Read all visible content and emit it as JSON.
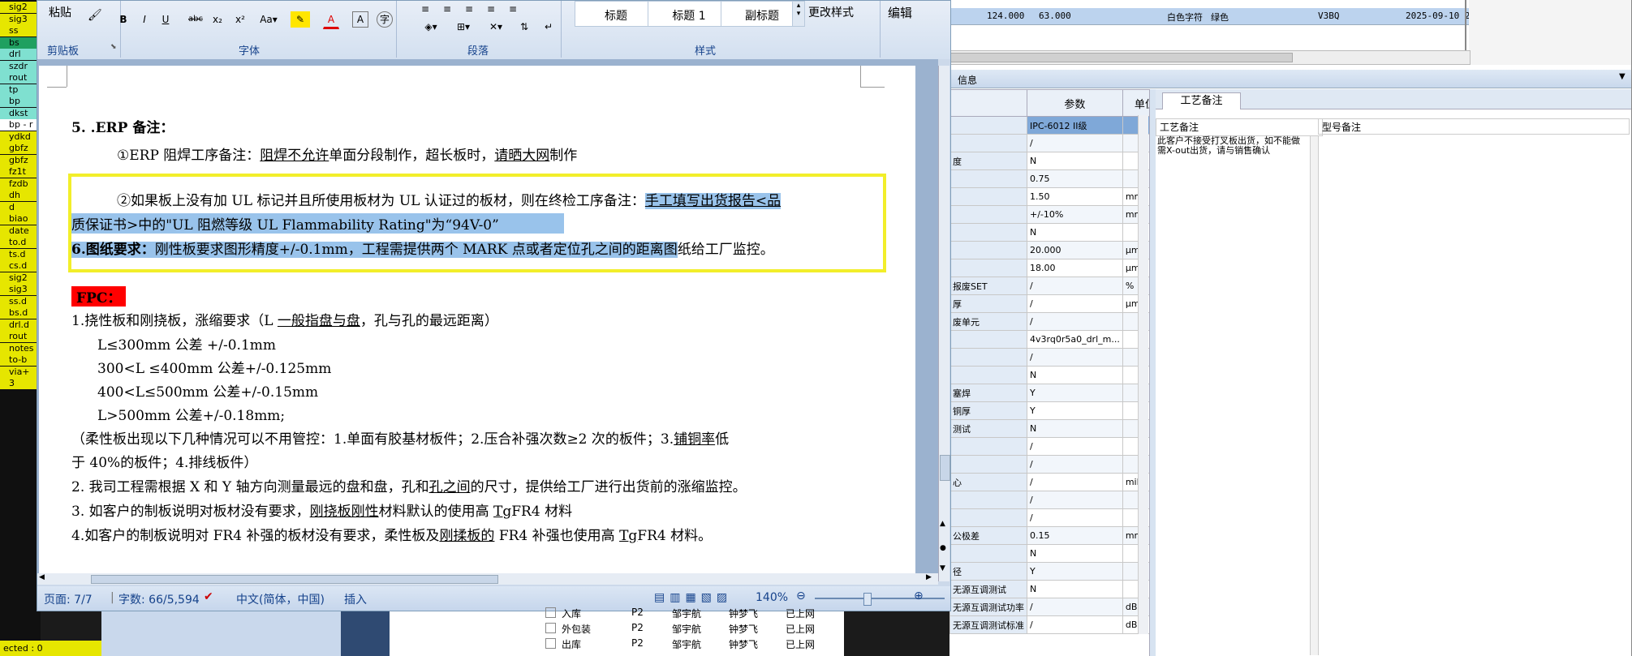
{
  "left_items": [
    {
      "t": "sig2",
      "c": "#e6e600"
    },
    {
      "t": "sig3",
      "c": "#e6e600"
    },
    {
      "t": "ss",
      "c": "#e6e600"
    },
    {
      "t": "bs",
      "c": "#1fa060"
    },
    {
      "t": "drl",
      "c": "#7fe0d0"
    },
    {
      "t": "szdr",
      "c": "#7fe0d0"
    },
    {
      "t": "rout",
      "c": "#7fe0d0"
    },
    {
      "t": "tp",
      "c": "#7fe0d0"
    },
    {
      "t": "bp",
      "c": "#7fe0d0"
    },
    {
      "t": "dkst",
      "c": "#7fe0d0"
    },
    {
      "t": "bp - r",
      "c": "#ffffff"
    },
    {
      "t": "ydkd",
      "c": "#e6e600"
    },
    {
      "t": "gbfz",
      "c": "#e6e600"
    },
    {
      "t": "gbfz",
      "c": "#e6e600"
    },
    {
      "t": "fz1t",
      "c": "#e6e600"
    },
    {
      "t": "fzdb",
      "c": "#e6e600"
    },
    {
      "t": "dh",
      "c": "#e6e600"
    },
    {
      "t": "d",
      "c": "#e6e600"
    },
    {
      "t": "biao",
      "c": "#e6e600"
    },
    {
      "t": "date",
      "c": "#e6e600"
    },
    {
      "t": "to.d",
      "c": "#e6e600"
    },
    {
      "t": "ts.d",
      "c": "#e6e600"
    },
    {
      "t": "cs.d",
      "c": "#e6e600"
    },
    {
      "t": "sig2",
      "c": "#e6e600"
    },
    {
      "t": "sig3",
      "c": "#e6e600"
    },
    {
      "t": "ss.d",
      "c": "#e6e600"
    },
    {
      "t": "bs.d",
      "c": "#e6e600"
    },
    {
      "t": "drl.d",
      "c": "#e6e600"
    },
    {
      "t": "rout",
      "c": "#e6e600"
    },
    {
      "t": "notes",
      "c": "#e6e600"
    },
    {
      "t": "to-b",
      "c": "#e6e600"
    },
    {
      "t": "via+",
      "c": "#e6e600"
    },
    {
      "t": "3",
      "c": "#e6e600"
    }
  ],
  "left_footer": "ected : 0",
  "word": {
    "ribbon": {
      "paste": "粘贴",
      "clipboard": "剪贴板",
      "font": "字体",
      "paragraph": "段落",
      "styles": "样式",
      "edit": "编辑",
      "change_styles": "更改样式",
      "style_boxes": [
        "标题",
        "标题 1",
        "副标题"
      ]
    },
    "doc": {
      "l1": "5. .ERP 备注：",
      "l2a": "①ERP 阻焊工序备注：",
      "l2b": "阻焊不允许",
      "l2c": "单面分段制作，超长板时，",
      "l2d": "请晒大网",
      "l2e": "制作",
      "l3a": "②如果板上没有加 UL 标记并且所使用板材为 UL 认证过的板材，则在终检工序备注：",
      "l3b": "手工填写出货报告<品",
      "l4": "质保证书>中的\"UL 阻燃等级 UL Flammability Rating\"为“94V-0”",
      "l5a": "6.图纸要求：",
      "l5b": "刚性板要求图形精度+/-0.1mm，工程需提供两个 MARK 点或者定位孔之间的距离图",
      "l5c": "纸给工厂监控。",
      "fpc": "FPC：",
      "l6a": "1.挠性板和刚挠板，涨缩要求（L ",
      "l6b": "一般指盘与盘",
      "l6c": "，孔与孔的最远距离）",
      "l7": "L≤300mm 公差 +/-0.1mm",
      "l8": "300<L ≤400mm 公差+/-0.125mm",
      "l9": "400<L≤500mm 公差+/-0.15mm",
      "l10": "L>500mm 公差+/-0.18mm;",
      "l11a": "（柔性板出现以下几种情况可以不用管控：1.单面有胶基材板件；2.压合补强次数≥2 次的板件；3.",
      "l11b": "铺铜率",
      "l11c": "低",
      "l12": "于 40%的板件；4.排线板件）",
      "l13a": "2.    我司工程需根据 X 和 Y 轴方向测量最远的盘和盘，孔和",
      "l13b": "孔之间",
      "l13c": "的尺寸，提供给工厂进行出货前的涨缩监控。",
      "l14a": "3. 如客户的制板说明对板材没有要求，",
      "l14b": "刚挠板刚性",
      "l14c": "材料默认的使用高 ",
      "l14d": "Tg",
      "l14e": "FR4 材料",
      "l15a": "4.如客户的制板说明对 FR4 补强的板材没有要求，柔性板及",
      "l15b": "刚揉板的",
      "l15c": " FR4 补强也使用高 ",
      "l15d": "Tg",
      "l15e": "FR4 材料。"
    },
    "status": {
      "page": "页面: 7/7",
      "words": "字数: 66/5,594",
      "lang": "中文(简体，中国)",
      "mode": "插入",
      "zoom": "140%"
    }
  },
  "right": {
    "top_row": {
      "a": "124.000",
      "b": "63.000",
      "c": "白色字符",
      "d": "绿色",
      "e": "V3BQ",
      "f": "2025-09-10 2"
    },
    "bar_label": "信息",
    "tab": "工艺备注",
    "col_param": "参数",
    "col_unit": "单位",
    "proc_col1": "工艺备注",
    "proc_col2": "型号备注",
    "proc_text": "此客户不接受打叉板出货，如不能做需X-out出货，请与销售确认",
    "rows": [
      {
        "n": "",
        "p": "IPC-6012 II级",
        "u": ""
      },
      {
        "n": "",
        "p": "/",
        "u": ""
      },
      {
        "n": "度",
        "p": "N",
        "u": ""
      },
      {
        "n": "",
        "p": "0.75",
        "u": ""
      },
      {
        "n": "",
        "p": "1.50",
        "u": "mm"
      },
      {
        "n": "",
        "p": "+/-10%",
        "u": "mm"
      },
      {
        "n": "",
        "p": "N",
        "u": ""
      },
      {
        "n": "",
        "p": "20.000",
        "u": "μm"
      },
      {
        "n": "",
        "p": "18.00",
        "u": "μm"
      },
      {
        "n": "报废SET",
        "p": "/",
        "u": "%"
      },
      {
        "n": "厚",
        "p": "/",
        "u": "μm"
      },
      {
        "n": "废单元",
        "p": "/",
        "u": ""
      },
      {
        "n": "",
        "p": "4v3rq0r5a0_drl_m...",
        "u": ""
      },
      {
        "n": "",
        "p": "/",
        "u": ""
      },
      {
        "n": "",
        "p": "N",
        "u": ""
      },
      {
        "n": "塞焊",
        "p": "Y",
        "u": ""
      },
      {
        "n": "铜厚",
        "p": "Y",
        "u": ""
      },
      {
        "n": "测试",
        "p": "N",
        "u": ""
      },
      {
        "n": "",
        "p": "/",
        "u": ""
      },
      {
        "n": "",
        "p": "/",
        "u": ""
      },
      {
        "n": "心",
        "p": "/",
        "u": "mil"
      },
      {
        "n": "",
        "p": "/",
        "u": ""
      },
      {
        "n": "",
        "p": "/",
        "u": ""
      },
      {
        "n": "公极差",
        "p": "0.15",
        "u": "mm/inch"
      },
      {
        "n": "",
        "p": "N",
        "u": ""
      },
      {
        "n": "径",
        "p": "Y",
        "u": ""
      },
      {
        "n": "无源互调测试",
        "p": "N",
        "u": ""
      },
      {
        "n": "无源互调测试功率",
        "p": "/",
        "u": "dBm"
      },
      {
        "n": "无源互调测试标准",
        "p": "/",
        "u": "dBm"
      }
    ]
  },
  "bg_tree": [
    {
      "name": "入库",
      "a": "P2",
      "b": "邹宇航",
      "c": "钟梦飞",
      "d": "已上网"
    },
    {
      "name": "外包装",
      "a": "P2",
      "b": "邹宇航",
      "c": "钟梦飞",
      "d": "已上网"
    },
    {
      "name": "出库",
      "a": "P2",
      "b": "邹宇航",
      "c": "钟梦飞",
      "d": "已上网"
    }
  ]
}
